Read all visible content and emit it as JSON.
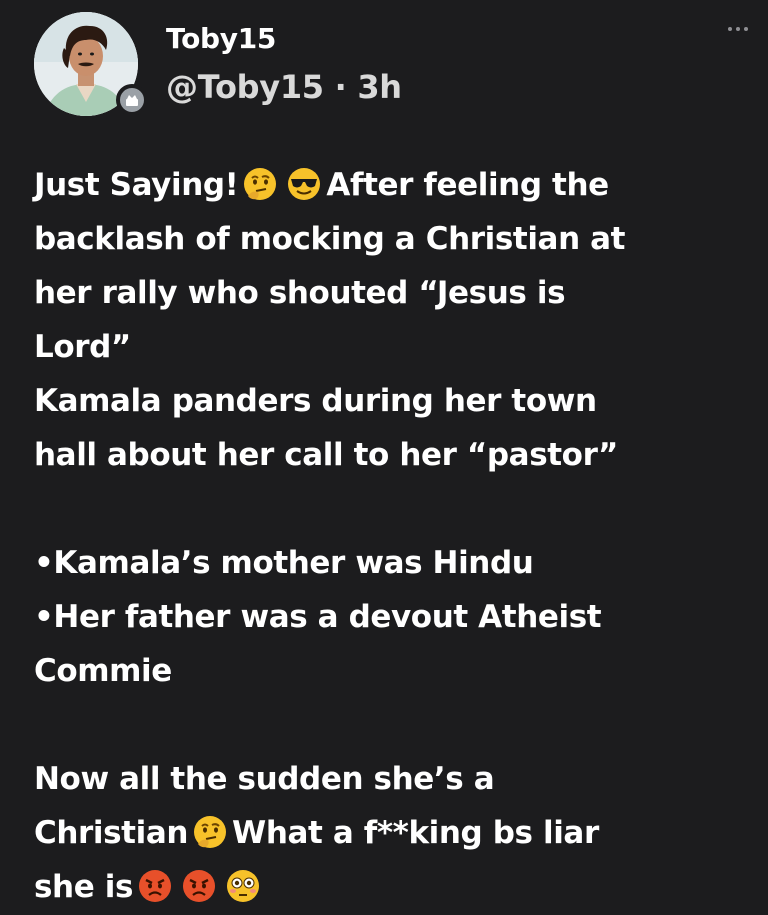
{
  "user": {
    "display_name": "Toby15",
    "handle": "@Toby15",
    "separator": "·",
    "time_ago": "3h"
  },
  "post": {
    "lines": [
      {
        "pre": "Just Saying!",
        "emojis": [
          "thinking-face",
          "smiling-face-with-sunglasses"
        ],
        "post": "After feeling the"
      },
      {
        "text": "backlash of mocking a Christian at"
      },
      {
        "text": "her rally who shouted “Jesus is"
      },
      {
        "text": "Lord”"
      },
      {
        "text": "Kamala panders during her town"
      },
      {
        "text": "hall about her call to her “pastor”"
      },
      {
        "blank": true
      },
      {
        "text": "•Kamala’s mother was Hindu"
      },
      {
        "text": "•Her father was a devout Atheist"
      },
      {
        "text": "Commie"
      },
      {
        "blank": true
      },
      {
        "text": "Now all the sudden she’s a"
      },
      {
        "pre": "Christian",
        "emojis": [
          "thinking-face"
        ],
        "post": "What a f**king bs liar"
      },
      {
        "pre": "she is",
        "emojis": [
          "angry-face",
          "angry-face",
          "flushed-face"
        ],
        "post": ""
      }
    ]
  },
  "colors": {
    "background": "#1c1c1e",
    "text": "#ffffff",
    "handle": "#d9d9d9",
    "emoji_yellow": "#f7c22a",
    "emoji_angry": "#e8502a"
  }
}
